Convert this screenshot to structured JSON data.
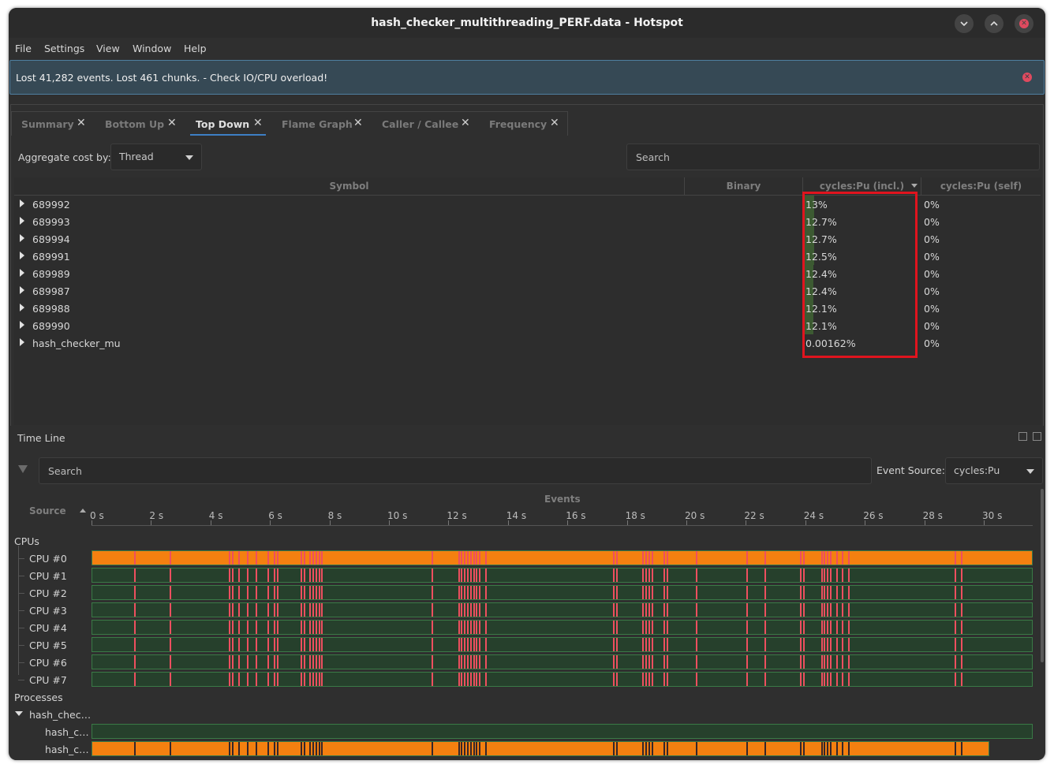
{
  "window": {
    "title": "hash_checker_multithreading_PERF.data - Hotspot"
  },
  "menu": [
    "File",
    "Settings",
    "View",
    "Window",
    "Help"
  ],
  "message": {
    "text": "Lost 41,282 events. Lost 461 chunks. - Check IO/CPU overload!"
  },
  "tabs": [
    "Summary",
    "Bottom Up",
    "Top Down",
    "Flame Graph",
    "Caller / Callee",
    "Frequency"
  ],
  "active_tab": "Top Down",
  "aggregate": {
    "label": "Aggregate cost by:",
    "value": "Thread"
  },
  "search": {
    "placeholder": "Search"
  },
  "table": {
    "headers": {
      "symbol": "Symbol",
      "binary": "Binary",
      "incl": "cycles:Pu (incl.)",
      "self": "cycles:Pu (self)"
    },
    "rows": [
      {
        "symbol": "689992",
        "incl": "13%",
        "self": "0%",
        "frac": 0.13
      },
      {
        "symbol": "689993",
        "incl": "12.7%",
        "self": "0%",
        "frac": 0.127
      },
      {
        "symbol": "689994",
        "incl": "12.7%",
        "self": "0%",
        "frac": 0.127
      },
      {
        "symbol": "689991",
        "incl": "12.5%",
        "self": "0%",
        "frac": 0.125
      },
      {
        "symbol": "689989",
        "incl": "12.4%",
        "self": "0%",
        "frac": 0.124
      },
      {
        "symbol": "689987",
        "incl": "12.4%",
        "self": "0%",
        "frac": 0.124
      },
      {
        "symbol": "689988",
        "incl": "12.1%",
        "self": "0%",
        "frac": 0.121
      },
      {
        "symbol": "689990",
        "incl": "12.1%",
        "self": "0%",
        "frac": 0.121
      },
      {
        "symbol": "hash_checker_mu",
        "incl": "0.00162%",
        "self": "0%",
        "frac": 1.62e-05
      }
    ]
  },
  "timeline": {
    "title": "Time Line",
    "search_placeholder": "Search",
    "event_source_label": "Event Source:",
    "event_source_value": "cycles:Pu",
    "events_header": "Events",
    "source_header": "Source",
    "ticks": [
      "0 s",
      "2 s",
      "4 s",
      "6 s",
      "8 s",
      "10 s",
      "12 s",
      "14 s",
      "16 s",
      "18 s",
      "20 s",
      "22 s",
      "24 s",
      "26 s",
      "28 s",
      "30 s"
    ],
    "cpus_group": "CPUs",
    "cpus": [
      "CPU #0",
      "CPU #1",
      "CPU #2",
      "CPU #3",
      "CPU #4",
      "CPU #5",
      "CPU #6",
      "CPU #7"
    ],
    "processes_group": "Processes",
    "process": "hash_chec…",
    "threads": [
      "hash_c…",
      "hash_c…"
    ],
    "marker_times_s": [
      1.4,
      2.6,
      4.6,
      4.7,
      4.9,
      5.2,
      5.5,
      5.9,
      6.1,
      6.2,
      7.0,
      7.1,
      7.3,
      7.4,
      7.5,
      7.6,
      7.7,
      11.4,
      12.3,
      12.4,
      12.5,
      12.6,
      12.7,
      12.8,
      12.9,
      13.0,
      13.2,
      17.5,
      17.6,
      18.5,
      18.6,
      18.7,
      18.8,
      19.2,
      19.3,
      20.3,
      22.0,
      22.6,
      23.8,
      23.9,
      24.5,
      24.6,
      24.7,
      24.8,
      25.0,
      25.2,
      25.4,
      29.0,
      29.2
    ],
    "colors": {
      "orange": "#f48010",
      "lane": "#26402c",
      "marker": "#ee4f5f"
    }
  }
}
